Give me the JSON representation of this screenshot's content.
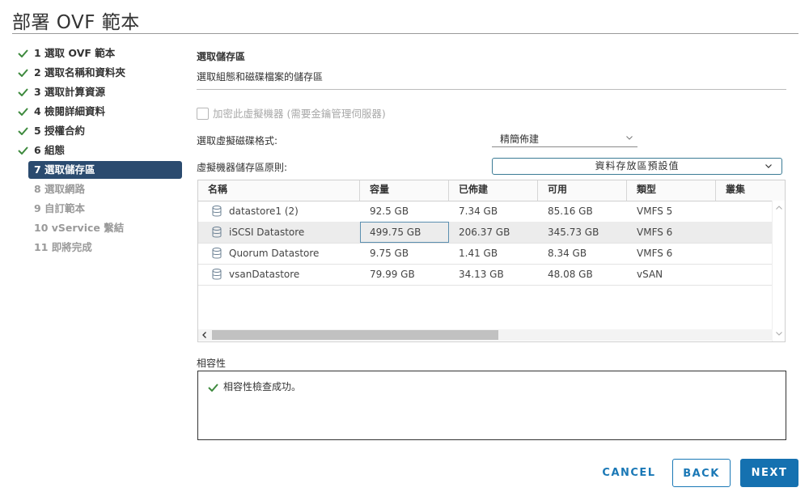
{
  "window": {
    "title": "部署 OVF 範本"
  },
  "steps": [
    {
      "label": "1 選取 OVF 範本",
      "state": "done"
    },
    {
      "label": "2 選取名稱和資料夾",
      "state": "done"
    },
    {
      "label": "3 選取計算資源",
      "state": "done"
    },
    {
      "label": "4 檢閱詳細資料",
      "state": "done"
    },
    {
      "label": "5 授權合約",
      "state": "done"
    },
    {
      "label": "6 組態",
      "state": "done"
    },
    {
      "label": "7 選取儲存區",
      "state": "active"
    },
    {
      "label": "8 選取網路",
      "state": "pending"
    },
    {
      "label": "9 自訂範本",
      "state": "pending"
    },
    {
      "label": "10 vService 繫結",
      "state": "pending"
    },
    {
      "label": "11 即將完成",
      "state": "pending"
    }
  ],
  "main": {
    "section_title": "選取儲存區",
    "section_subtitle": "選取組態和磁碟檔案的儲存區",
    "encrypt_label": "加密此虛擬機器 (需要金鑰管理伺服器)",
    "disk_format_label": "選取虛擬磁碟格式:",
    "disk_format_value": "精簡佈建",
    "policy_label": "虛擬機器儲存區原則:",
    "policy_value": "資料存放區預設值",
    "table": {
      "columns": [
        "名稱",
        "容量",
        "已佈建",
        "可用",
        "類型",
        "叢集"
      ],
      "rows": [
        {
          "name": "datastore1 (2)",
          "capacity": "92.5 GB",
          "provisioned": "7.34 GB",
          "free": "85.16 GB",
          "type": "VMFS 5",
          "cluster": ""
        },
        {
          "name": "iSCSI Datastore",
          "capacity": "499.75 GB",
          "provisioned": "206.37 GB",
          "free": "345.73 GB",
          "type": "VMFS 6",
          "cluster": ""
        },
        {
          "name": "Quorum Datastore",
          "capacity": "9.75 GB",
          "provisioned": "1.41 GB",
          "free": "8.34 GB",
          "type": "VMFS 6",
          "cluster": ""
        },
        {
          "name": "vsanDatastore",
          "capacity": "79.99 GB",
          "provisioned": "34.13 GB",
          "free": "48.08 GB",
          "type": "vSAN",
          "cluster": ""
        }
      ],
      "selected_row": 1
    },
    "compat_label": "相容性",
    "compat_message": "相容性檢查成功。"
  },
  "footer": {
    "cancel": "CANCEL",
    "back": "BACK",
    "next": "NEXT"
  },
  "colors": {
    "accent": "#1571b0",
    "active_step": "#2b4b6f",
    "check": "#3e8a3e"
  }
}
